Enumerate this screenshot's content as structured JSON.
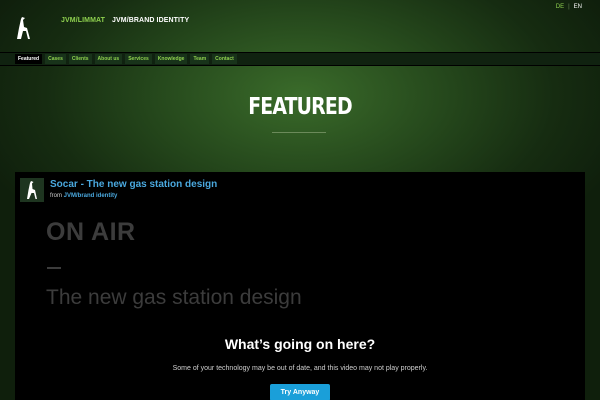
{
  "header": {
    "brand_primary": "JVM/LIMMAT",
    "brand_secondary": "JVM/BRAND IDENTITY",
    "languages": {
      "de": "DE",
      "separator": "|",
      "en": "EN"
    }
  },
  "nav": {
    "items": [
      {
        "label": "Featured",
        "active": true
      },
      {
        "label": "Cases"
      },
      {
        "label": "Clients"
      },
      {
        "label": "About us"
      },
      {
        "label": "Services"
      },
      {
        "label": "Knowledge"
      },
      {
        "label": "Team"
      },
      {
        "label": "Contact"
      }
    ]
  },
  "hero": {
    "title": "FEATURED"
  },
  "video": {
    "title": "Socar - The new gas station design",
    "from_prefix": "from",
    "from_link": "JVM/brand identity",
    "overlay_heading": "ON AIR",
    "overlay_subline": "The new gas station design",
    "error_title": "What’s going on here?",
    "error_text": "Some of your technology may be out of date, and this video may not play properly.",
    "button_label": "Try Anyway"
  },
  "colors": {
    "accent_green": "#8fd14f",
    "link_blue": "#4aa8de",
    "button_blue": "#1a9fd9"
  },
  "icons": {
    "logo": "giraffe-logo-icon",
    "thumbnail": "giraffe-thumbnail-icon"
  }
}
